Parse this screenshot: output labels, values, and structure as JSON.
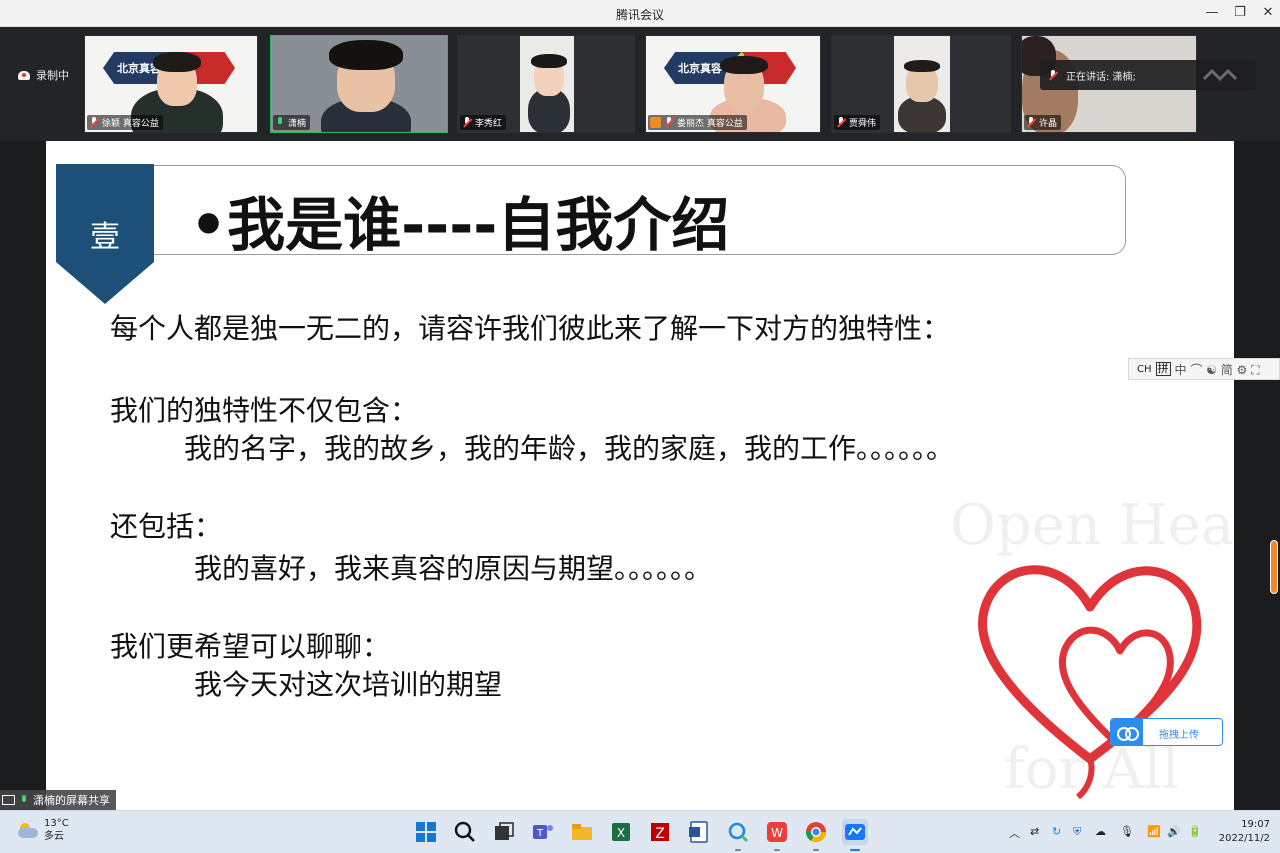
{
  "window": {
    "title": "腾讯会议"
  },
  "recording": {
    "label": "录制中"
  },
  "participants": [
    {
      "name": "徐颖 真容公益"
    },
    {
      "name": "潇楠"
    },
    {
      "name": "李秀红"
    },
    {
      "name": "娄丽杰 真容公益"
    },
    {
      "name": "贾舜伟"
    },
    {
      "name": "许晶"
    }
  ],
  "banner": {
    "text": "北京真容      会"
  },
  "speaking": {
    "label": "正在讲话: 潇楠;"
  },
  "slide": {
    "badge": "壹",
    "title": "•我是谁----自我介绍",
    "lines": [
      "每个人都是独一无二的，请容许我们彼此来了解一下对方的独特性：",
      "我们的独特性不仅包含：",
      "我的名字，我的故乡，我的年龄，我的家庭，我的工作。。。。。。",
      "还包括：",
      "我的喜好，我来真容的原因与期望。。。。。。",
      "我们更希望可以聊聊：",
      "我今天对这次培训的期望"
    ],
    "watermark_top": "Open Hearts",
    "watermark_bottom": "for All"
  },
  "ime": {
    "lang": "CH",
    "mode": "拼",
    "extras": "中 ⌒ ☯ 简 ⚙ ⛶"
  },
  "upload": {
    "label": "拖拽上传"
  },
  "share": {
    "label": "潇楠的屏幕共享"
  },
  "taskbar": {
    "weather": {
      "temp": "13°C",
      "condition": "多云"
    },
    "time": "19:07",
    "date": "2022/11/2"
  },
  "colors": {
    "accent_green": "#28b765",
    "slide_blue": "#1d5079",
    "heart_red": "#e0343b"
  }
}
